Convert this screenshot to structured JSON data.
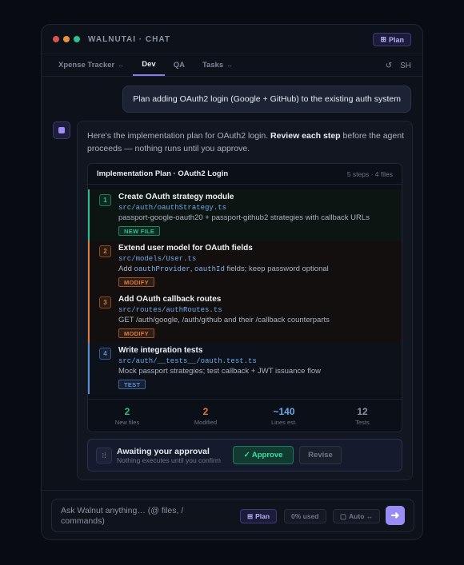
{
  "window": {
    "title": "WALNUTAI · CHAT",
    "mode_badge": "Plan",
    "traffic_colors": [
      "#d9534f",
      "#e8913a",
      "#2fbf8b"
    ]
  },
  "tabs": [
    {
      "label": "Xpense Tracker",
      "suffix": "↔",
      "active": false
    },
    {
      "label": "Dev",
      "suffix": "",
      "active": true
    },
    {
      "label": "QA",
      "suffix": "",
      "active": false
    },
    {
      "label": "Tasks",
      "suffix": "↔",
      "active": false
    }
  ],
  "tab_tools": {
    "refresh_icon": "↺",
    "user_initials": "SH"
  },
  "user_message": "Plan adding OAuth2 login (Google + GitHub) to the existing auth system",
  "assistant": {
    "intro_before": "Here's the implementation plan for OAuth2 login. ",
    "intro_bold": "Review each step",
    "intro_after": " before the agent proceeds — nothing runs until you approve."
  },
  "plan": {
    "title": "Implementation Plan · OAuth2 Login",
    "meta": "5 steps · 4 files",
    "steps": [
      {
        "num": "1",
        "title": "Create OAuth strategy module",
        "path": "src/auth/oauthStrategy.ts",
        "desc_parts": [
          {
            "t": "passport-google-oauth20 + passport-github2 strategies with callback URLs",
            "code": false
          }
        ],
        "tag": "NEW FILE",
        "color": "#2fbf8b",
        "bg": "#0c1512"
      },
      {
        "num": "2",
        "title": "Extend user model for OAuth fields",
        "path": "src/models/User.ts",
        "desc_parts": [
          {
            "t": "Add ",
            "code": false
          },
          {
            "t": "oauthProvider",
            "code": true
          },
          {
            "t": ", ",
            "code": false
          },
          {
            "t": "oauthId",
            "code": true
          },
          {
            "t": " fields; keep password optional",
            "code": false
          }
        ],
        "tag": "MODIFY",
        "color": "#e07a3a",
        "bg": "#130f0e"
      },
      {
        "num": "3",
        "title": "Add OAuth callback routes",
        "path": "src/routes/authRoutes.ts",
        "desc_parts": [
          {
            "t": "GET /auth/google, /auth/github and their /callback counterparts",
            "code": false
          }
        ],
        "tag": "MODIFY",
        "color": "#e07a3a",
        "bg": "#130f0e"
      },
      {
        "num": "4",
        "title": "Write integration tests",
        "path": "src/auth/__tests__/oauth.test.ts",
        "desc_parts": [
          {
            "t": "Mock passport strategies; test callback + JWT issuance flow",
            "code": false
          }
        ],
        "tag": "TEST",
        "color": "#5b8fd8",
        "bg": "#0d111a"
      }
    ],
    "stats": [
      {
        "value": "2",
        "label": "New files",
        "color": "#2fbf8b"
      },
      {
        "value": "2",
        "label": "Modified",
        "color": "#e07a3a"
      },
      {
        "value": "~140",
        "label": "Lines est.",
        "color": "#6ea8e8"
      },
      {
        "value": "12",
        "label": "Tests",
        "color": "#8a93a3"
      }
    ]
  },
  "approval": {
    "title": "Awaiting your approval",
    "subtitle": "Nothing executes until you confirm",
    "approve_label": "✓ Approve",
    "revise_label": "Revise"
  },
  "composer": {
    "placeholder": "Ask Walnut anything… (@ files, / commands)",
    "plan_chip": "Plan",
    "usage_chip": "0% used",
    "auto_chip": "Auto ↔"
  }
}
